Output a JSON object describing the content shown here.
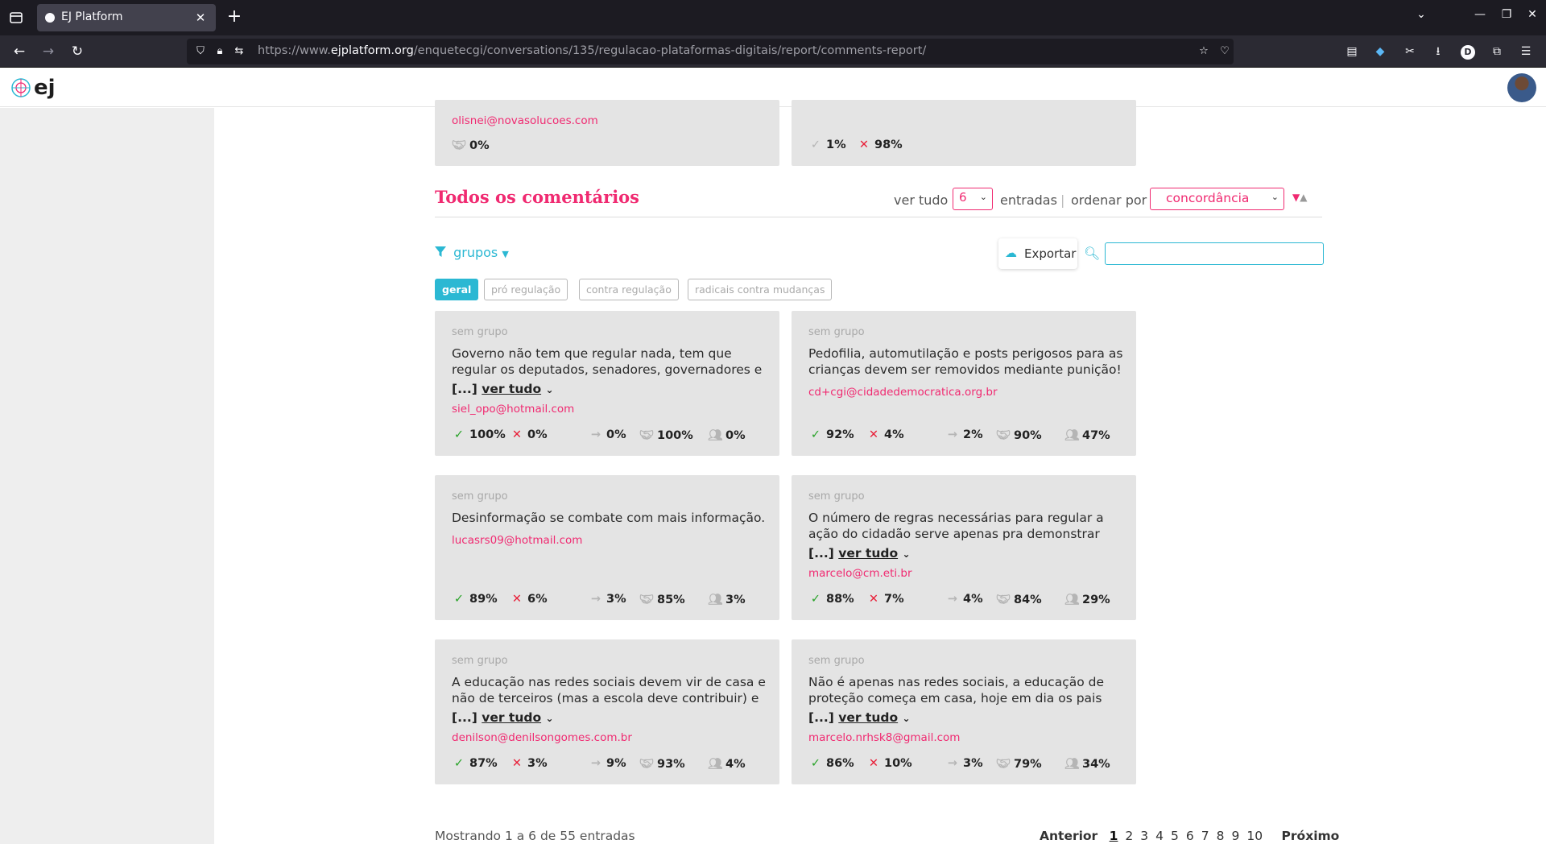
{
  "browser": {
    "tab_title": "EJ Platform",
    "url_prefix": "https://www.",
    "url_host": "ejplatform.org",
    "url_path": "/enquetecgi/conversations/135/regulacao-plataformas-digitais/report/comments-report/",
    "profile_letter": "D"
  },
  "site": {
    "logo_text": "ej"
  },
  "top_cards": [
    {
      "author": "olisnei@novasolucoes.com",
      "stats": {
        "pass": "0%"
      }
    },
    {
      "stats": {
        "agree": "1%",
        "disagree": "98%"
      }
    }
  ],
  "section": {
    "title": "Todos os comentários",
    "show_all_label": "ver tudo",
    "entries_value": "6",
    "entries_label": "entradas",
    "separator": "|",
    "sort_label": "ordenar por",
    "sort_value": "concordância"
  },
  "filter": {
    "label": "grupos",
    "export_label": "Exportar",
    "search_placeholder": "",
    "chips": [
      "geral",
      "pró regulação",
      "contra regulação",
      "radicais contra mudanças"
    ]
  },
  "comments": [
    {
      "group": "sem grupo",
      "text": "Governo não tem que regular nada, tem que regular os deputados, senadores, governadores e",
      "more": "[...]",
      "more_link": "ver tudo",
      "author": "siel_opo@hotmail.com",
      "agree": "100%",
      "disagree": "0%",
      "skip": "0%",
      "pass": "100%",
      "participation": "0%"
    },
    {
      "group": "sem grupo",
      "text": "Pedofilia, automutilação e posts perigosos para as crianças devem ser removidos mediante punição!",
      "more": "",
      "more_link": "",
      "author": "cd+cgi@cidadedemocratica.org.br",
      "agree": "92%",
      "disagree": "4%",
      "skip": "2%",
      "pass": "90%",
      "participation": "47%"
    },
    {
      "group": "sem grupo",
      "text": "Desinformação se combate com mais informação.",
      "more": "",
      "more_link": "",
      "author": "lucasrs09@hotmail.com",
      "agree": "89%",
      "disagree": "6%",
      "skip": "3%",
      "pass": "85%",
      "participation": "3%"
    },
    {
      "group": "sem grupo",
      "text": "O número de regras necessárias para regular a ação do cidadão serve apenas pra demonstrar",
      "more": "[...]",
      "more_link": "ver tudo",
      "author": "marcelo@cm.eti.br",
      "agree": "88%",
      "disagree": "7%",
      "skip": "4%",
      "pass": "84%",
      "participation": "29%"
    },
    {
      "group": "sem grupo",
      "text": "A educação nas redes sociais devem vir de casa e não de terceiros (mas a escola deve contribuir) e",
      "more": "[...]",
      "more_link": "ver tudo",
      "author": "denilson@denilsongomes.com.br",
      "agree": "87%",
      "disagree": "3%",
      "skip": "9%",
      "pass": "93%",
      "participation": "4%"
    },
    {
      "group": "sem grupo",
      "text": "Não é apenas nas redes sociais, a educação de proteção começa em casa, hoje em dia os pais",
      "more": "[...]",
      "more_link": "ver tudo",
      "author": "marcelo.nrhsk8@gmail.com",
      "agree": "86%",
      "disagree": "10%",
      "skip": "3%",
      "pass": "79%",
      "participation": "34%"
    }
  ],
  "footer": {
    "info": "Mostrando 1 a 6 de 55 entradas",
    "prev": "Anterior",
    "pages": [
      "1",
      "2",
      "3",
      "4",
      "5",
      "6",
      "7",
      "8",
      "9",
      "10"
    ],
    "next": "Próximo"
  },
  "colors": {
    "accent": "#f02a71",
    "secondary": "#2bb8d3",
    "agree": "#29a329",
    "disagree": "#e8213a"
  }
}
